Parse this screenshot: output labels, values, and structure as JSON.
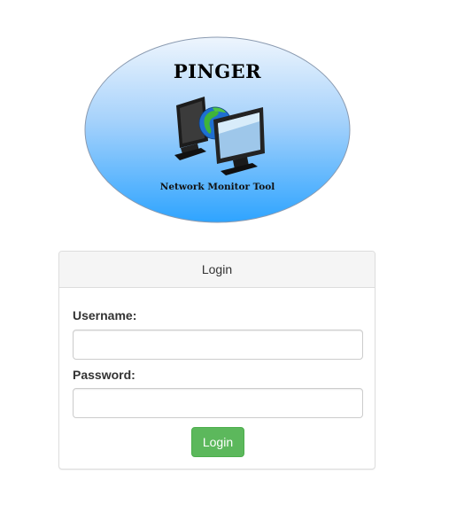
{
  "logo": {
    "title": "PINGER",
    "subtitle": "Network Monitor Tool",
    "icon": "networked-monitors-globe-icon",
    "gradient_top": "#e8f2fd",
    "gradient_bottom": "#2ea4ff"
  },
  "login_panel": {
    "heading": "Login",
    "username_label": "Username:",
    "username_value": "",
    "password_label": "Password:",
    "password_value": "",
    "submit_label": "Login",
    "submit_color": "#5cb85c"
  }
}
